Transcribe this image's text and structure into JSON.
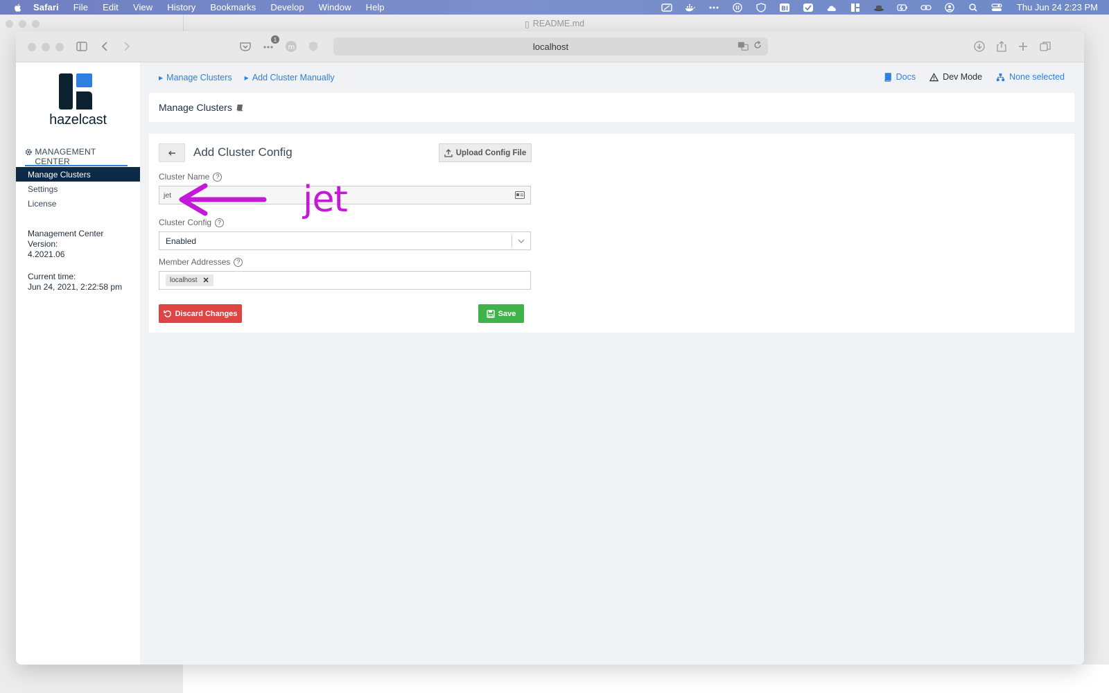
{
  "menubar": {
    "app": "Safari",
    "items": [
      "File",
      "Edit",
      "View",
      "History",
      "Bookmarks",
      "Develop",
      "Window",
      "Help"
    ],
    "clock": "Thu Jun 24  2:23 PM"
  },
  "background_window": {
    "title": "README.md"
  },
  "browser": {
    "address": "localhost",
    "tab_count_badge": "1"
  },
  "sidebar": {
    "brand": "hazelcast",
    "section_title": "MANAGEMENT CENTER",
    "nav": [
      {
        "label": "Manage Clusters",
        "active": true
      },
      {
        "label": "Settings",
        "active": false
      },
      {
        "label": "License",
        "active": false
      }
    ],
    "version_label": "Management Center Version:",
    "version_value": "4.2021.06",
    "time_label": "Current time:",
    "time_value": "Jun 24, 2021, 2:22:58 pm"
  },
  "breadcrumbs": [
    "Manage Clusters",
    "Add Cluster Manually"
  ],
  "topbar_right": {
    "docs": "Docs",
    "dev_mode": "Dev Mode",
    "selection": "None selected"
  },
  "page_title": "Manage Clusters",
  "form": {
    "title": "Add Cluster Config",
    "upload_button": "Upload Config File",
    "cluster_name_label": "Cluster Name",
    "cluster_name_value": "jet",
    "cluster_config_label": "Cluster Config",
    "cluster_config_value": "Enabled",
    "member_addresses_label": "Member Addresses",
    "member_addresses": [
      "localhost"
    ],
    "discard_button": "Discard Changes",
    "save_button": "Save"
  },
  "annotation": {
    "text": "jet",
    "color": "#c21ad6"
  },
  "colors": {
    "accent": "#2d7fe0",
    "nav_active": "#0c2a46",
    "danger": "#df4444",
    "success": "#3fb24a"
  }
}
